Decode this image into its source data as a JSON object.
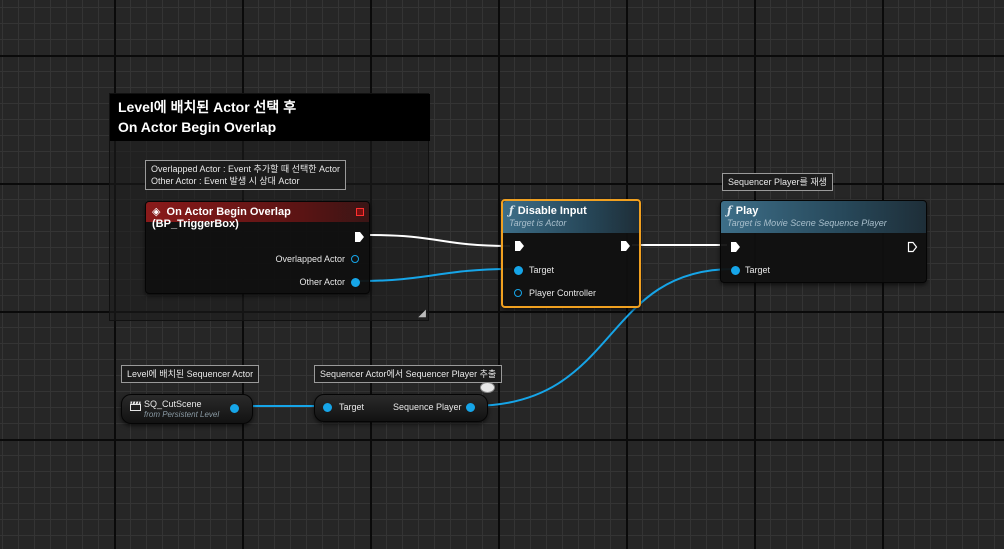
{
  "comment": {
    "title_line1": "Level에 배치된 Actor 선택 후",
    "title_line2": "On Actor Begin Overlap"
  },
  "event_node": {
    "tooltip_line1": "Overlapped Actor : Event 추가할 때 선택한 Actor",
    "tooltip_line2": "Other Actor : Event 발생 시 상대 Actor",
    "title": "On Actor Begin Overlap (BP_TriggerBox)",
    "pin_overlapped_actor": "Overlapped Actor",
    "pin_other_actor": "Other Actor",
    "header_color": "#8a1a1a",
    "icon": "event-diamond-icon"
  },
  "disable_input_node": {
    "title": "Disable Input",
    "subtitle": "Target is Actor",
    "pin_target": "Target",
    "pin_player_controller": "Player Controller",
    "icon": "function-icon"
  },
  "play_node": {
    "tooltip": "Sequencer Player를 재생",
    "title": "Play",
    "subtitle": "Target is Movie Scene Sequence Player",
    "pin_target": "Target",
    "icon": "function-icon"
  },
  "actor_ref_node": {
    "tooltip": "Level에 배치된 Sequencer Actor",
    "title": "SQ_CutScene",
    "subtitle": "from Persistent Level",
    "icon": "clapperboard-icon"
  },
  "getter_node": {
    "tooltip": "Sequencer Actor에서 Sequencer Player 추출",
    "pin_target": "Target",
    "pin_sequence_player": "Sequence Player"
  },
  "colors": {
    "object_pin": "#16a5e8",
    "exec_pin": "#ffffff",
    "selection": "#f0a020"
  }
}
